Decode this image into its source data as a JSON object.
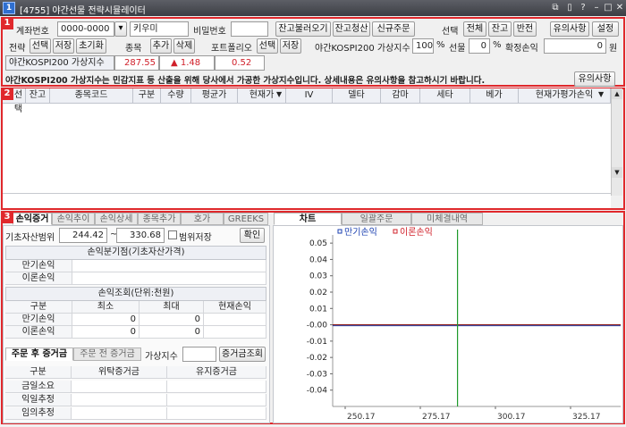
{
  "window": {
    "app_id": "1",
    "title": "[4755] 야간선물 전략시뮬레이터"
  },
  "section_badges": [
    "1",
    "2",
    "3"
  ],
  "top": {
    "account_label": "계좌번호",
    "account_value": "0000-0000",
    "account_name": "키우미",
    "password_label": "비밀번호",
    "password_value": "",
    "load_balance_btn": "잔고불러오기",
    "clear_balance_btn": "잔고청산",
    "new_order_btn": "신규주문",
    "select_label": "선택",
    "select_all_btn": "전체",
    "select_balance_btn": "잔고",
    "select_invert_btn": "반전",
    "notice_btn": "유의사항",
    "settings_btn": "설정",
    "strategy_label": "전략",
    "strategy_select_btn": "선택",
    "strategy_save_btn": "저장",
    "strategy_reset_btn": "초기화",
    "item_label": "종목",
    "item_add_btn": "추가",
    "item_delete_btn": "삭제",
    "portfolio_label": "포트폴리오",
    "portfolio_select_btn": "선택",
    "portfolio_save_btn": "저장",
    "vix_label": "야간KOSPI200 가상지수",
    "vix_value": "100",
    "pct1": "%",
    "futures_label": "선물",
    "futures_value": "0",
    "pct2": "%",
    "pnl_label": "확정손익",
    "pnl_value": "0",
    "won": "원",
    "index_label": "야간KOSPI200 가상지수",
    "index_value": "287.55",
    "index_change": "▲ 1.48",
    "index_rate": "0.52",
    "notice_text": "야간KOSPI200 가상지수는 민감지표 등 산출을 위해 당사에서 가공한 가상지수입니다. 상세내용은 유의사항을 참고하시기 바랍니다.",
    "notice_btn2": "유의사항"
  },
  "grid": {
    "columns": [
      "선택",
      "잔고",
      "종목코드",
      "구분",
      "수량",
      "평균가",
      "현재가",
      "IV",
      "델타",
      "감마",
      "세타",
      "베가",
      "현재가평가손익"
    ]
  },
  "bottom_left": {
    "tabs": [
      "손익증거금",
      "손익추이",
      "손익상세",
      "종목추가",
      "호가",
      "GREEKS"
    ],
    "range_label": "기초자산범위",
    "range_from": "244.42",
    "range_tilde": "~",
    "range_to": "330.68",
    "range_save_label": "범위저장",
    "confirm_btn": "확인",
    "pnl_dist_title": "손익분기점(기초자산가격)",
    "pnl_rows": [
      "만기손익",
      "이론손익"
    ],
    "pnl_query_title": "손익조회(단위:천원)",
    "query_headers": [
      "구분",
      "최소",
      "최대",
      "현재손익"
    ],
    "query_rows": [
      {
        "label": "만기손익",
        "min": "0",
        "max": "0",
        "cur": ""
      },
      {
        "label": "이론손익",
        "min": "0",
        "max": "0",
        "cur": ""
      }
    ],
    "margin_tabs": [
      "주문 후 증거금",
      "주문 전 증거금"
    ],
    "virtual_label": "가상지수",
    "virtual_value": "",
    "margin_query_btn": "증거금조회",
    "margin_headers": [
      "구분",
      "위탁증거금",
      "유지증거금"
    ],
    "margin_rows": [
      "금일소요",
      "익일추정",
      "임의추정"
    ]
  },
  "chart_panel": {
    "tabs": [
      "차트",
      "일괄주문",
      "미체결내역"
    ]
  },
  "chart_data": {
    "type": "line",
    "series": [
      {
        "name": "만기손익",
        "color": "#1a3fb0"
      },
      {
        "name": "이론손익",
        "color": "#d0202a"
      }
    ],
    "y_ticks": [
      "0.05",
      "0.04",
      "0.03",
      "0.02",
      "0.01",
      "-0.00",
      "-0.01",
      "-0.02",
      "-0.03",
      "-0.04"
    ],
    "x_ticks": [
      "250.17",
      "275.17",
      "300.17",
      "325.17"
    ],
    "ylim": [
      -0.05,
      0.055
    ],
    "zero_line_y": 0,
    "vertical_marker_x": 287.55,
    "colors": {
      "marker": "#1e9a2a",
      "zero_line": "#8b1a1a"
    }
  }
}
